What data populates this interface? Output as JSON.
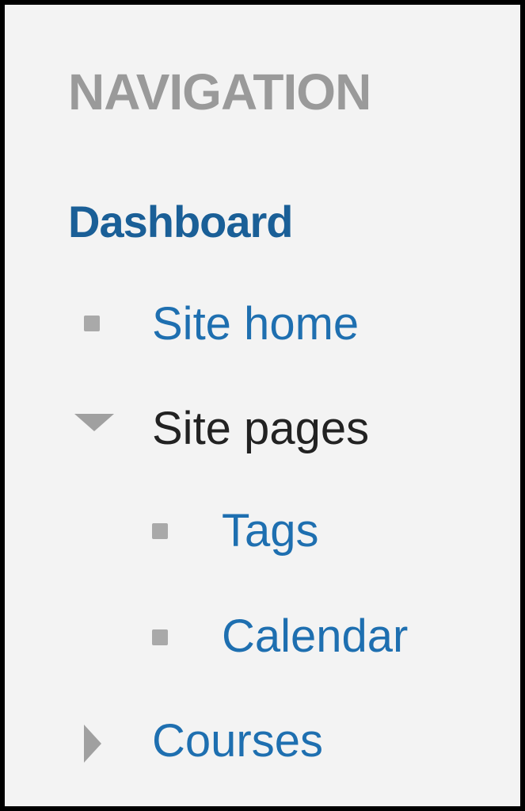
{
  "navigation": {
    "heading": "NAVIGATION",
    "items": [
      {
        "label": "Dashboard",
        "icon": "none",
        "type": "link"
      },
      {
        "label": "Site home",
        "icon": "bullet-icon",
        "type": "link"
      },
      {
        "label": "Site pages",
        "icon": "caret-down-icon",
        "type": "branch",
        "expanded": true,
        "children": [
          {
            "label": "Tags",
            "icon": "bullet-icon",
            "type": "link"
          },
          {
            "label": "Calendar",
            "icon": "bullet-icon",
            "type": "link"
          }
        ]
      },
      {
        "label": "Courses",
        "icon": "caret-right-icon",
        "type": "branch",
        "expanded": false
      }
    ]
  },
  "colors": {
    "heading": "#9a9a9a",
    "link": "#1e6fb0",
    "dashboard": "#1a5f97",
    "text": "#222222",
    "icon": "#a0a0a0",
    "background": "#f3f3f3",
    "border": "#000000"
  }
}
